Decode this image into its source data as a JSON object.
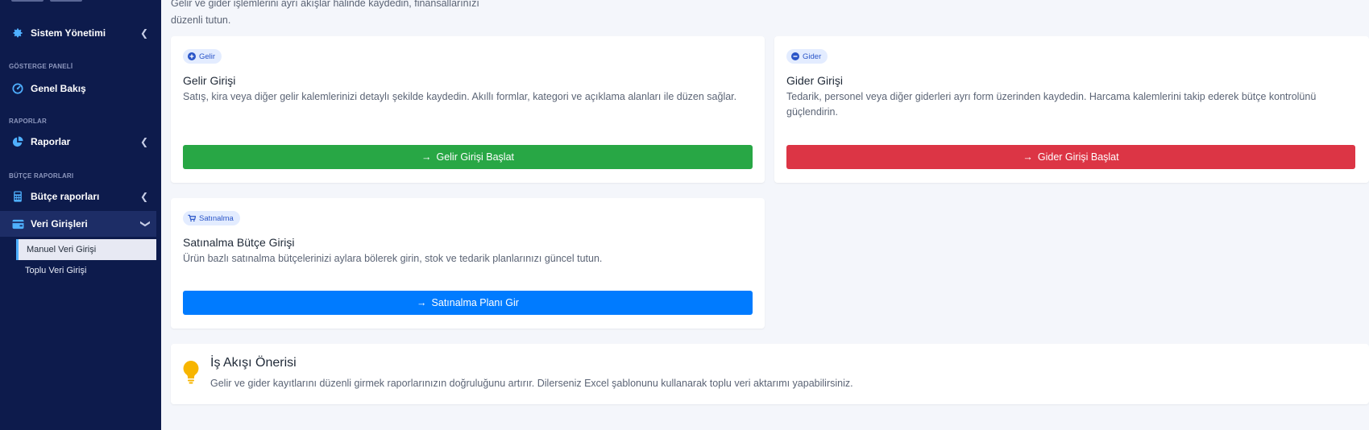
{
  "sidebar": {
    "items": {
      "sistem": {
        "label": "Sistem Yönetimi",
        "icon": "gear-icon"
      },
      "genel": {
        "label": "Genel Bakış",
        "icon": "dashboard-gauge-icon"
      },
      "raporlar": {
        "label": "Raporlar",
        "icon": "pie-chart-icon"
      },
      "butce": {
        "label": "Bütçe raporları",
        "icon": "calculator-icon"
      },
      "veri": {
        "label": "Veri Girişleri",
        "icon": "wallet-icon"
      }
    },
    "sections": {
      "gosterge": "GÖSTERGE PANELİ",
      "raporlar": "RAPORLAR",
      "butce": "BÜTÇE RAPORLARI"
    },
    "sub_items": {
      "manuel": "Manuel Veri Girişi",
      "toplu": "Toplu Veri Girişi"
    }
  },
  "intro": {
    "line1": "Gelir ve gider işlemlerini ayrı akışlar halinde kaydedin, finansallarınızı",
    "line2": "düzenli tutun."
  },
  "cards": {
    "gelir": {
      "badge": "Gelir",
      "title": "Gelir Girişi",
      "desc": "Satış, kira veya diğer gelir kalemlerinizi detaylı şekilde kaydedin. Akıllı formlar, kategori ve açıklama alanları ile düzen sağlar.",
      "button": "Gelir Girişi Başlat",
      "color": "#28a745"
    },
    "gider": {
      "badge": "Gider",
      "title": "Gider Girişi",
      "desc": "Tedarik, personel veya diğer giderleri ayrı form üzerinden kaydedin. Harcama kalemlerini takip ederek bütçe kontrolünü güçlendirin.",
      "button": "Gider Girişi Başlat",
      "color": "#dc3545"
    },
    "satinalma": {
      "badge": "Satınalma",
      "title": "Satınalma Bütçe Girişi",
      "desc": "Ürün bazlı satınalma bütçelerinizi aylara bölerek girin, stok ve tedarik planlarınızı güncel tutun.",
      "button": "Satınalma Planı Gir",
      "color": "#007bff"
    }
  },
  "tip": {
    "title": "İş Akışı Önerisi",
    "text": "Gelir ve gider kayıtlarını düzenli girmek raporlarınızın doğruluğunu artırır. Dilerseniz Excel şablonunu kullanarak toplu veri aktarımı yapabilirsiniz.",
    "icon": "lightbulb-icon"
  }
}
